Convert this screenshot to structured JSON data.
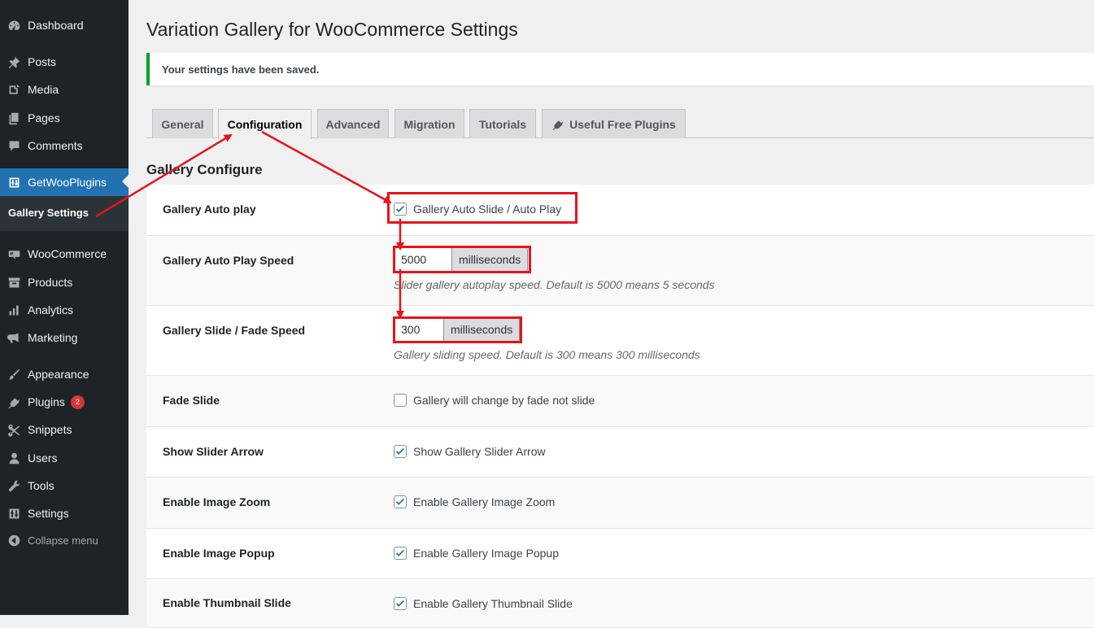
{
  "sidebar": {
    "items": [
      {
        "label": "Dashboard",
        "icon": "dashboard-icon"
      },
      {
        "label": "Posts",
        "icon": "pin-icon"
      },
      {
        "label": "Media",
        "icon": "media-icon"
      },
      {
        "label": "Pages",
        "icon": "pages-icon"
      },
      {
        "label": "Comments",
        "icon": "comment-icon"
      },
      {
        "label": "GetWooPlugins",
        "icon": "plugin-settings-icon"
      },
      {
        "label": "WooCommerce",
        "icon": "woo-icon"
      },
      {
        "label": "Products",
        "icon": "archive-icon"
      },
      {
        "label": "Analytics",
        "icon": "bar-chart-icon"
      },
      {
        "label": "Marketing",
        "icon": "megaphone-icon"
      },
      {
        "label": "Appearance",
        "icon": "brush-icon"
      },
      {
        "label": "Plugins",
        "icon": "plug-icon",
        "badge": "2"
      },
      {
        "label": "Snippets",
        "icon": "scissors-icon"
      },
      {
        "label": "Users",
        "icon": "user-icon"
      },
      {
        "label": "Tools",
        "icon": "wrench-icon"
      },
      {
        "label": "Settings",
        "icon": "settings-icon"
      },
      {
        "label": "Collapse menu",
        "icon": "collapse-icon"
      }
    ],
    "submenu": {
      "label": "Gallery Settings"
    }
  },
  "page": {
    "title": "Variation Gallery for WooCommerce Settings",
    "notice": "Your settings have been saved.",
    "section_title": "Gallery Configure"
  },
  "tabs": [
    {
      "label": "General"
    },
    {
      "label": "Configuration"
    },
    {
      "label": "Advanced"
    },
    {
      "label": "Migration"
    },
    {
      "label": "Tutorials"
    },
    {
      "label": "Useful Free Plugins",
      "icon": "plug-icon"
    }
  ],
  "settings": {
    "auto_play": {
      "label": "Gallery Auto play",
      "checkbox_label": "Gallery Auto Slide / Auto Play",
      "checked": true
    },
    "auto_play_speed": {
      "label": "Gallery Auto Play Speed",
      "value": "5000",
      "unit": "milliseconds",
      "description": "Slider gallery autoplay speed. Default is 5000 means 5 seconds"
    },
    "slide_speed": {
      "label": "Gallery Slide / Fade Speed",
      "value": "300",
      "unit": "milliseconds",
      "description": "Gallery sliding speed. Default is 300 means 300 milliseconds"
    },
    "fade_slide": {
      "label": "Fade Slide",
      "checkbox_label": "Gallery will change by fade not slide",
      "checked": false
    },
    "slider_arrow": {
      "label": "Show Slider Arrow",
      "checkbox_label": "Show Gallery Slider Arrow",
      "checked": true
    },
    "image_zoom": {
      "label": "Enable Image Zoom",
      "checkbox_label": "Enable Gallery Image Zoom",
      "checked": true
    },
    "image_popup": {
      "label": "Enable Image Popup",
      "checkbox_label": "Enable Gallery Image Popup",
      "checked": true
    },
    "thumbnail_slide": {
      "label": "Enable Thumbnail Slide",
      "checkbox_label": "Enable Gallery Thumbnail Slide",
      "checked": true
    }
  },
  "colors": {
    "sidebar_bg": "#1d2327",
    "active_menu": "#2271b1",
    "success": "#00a32a",
    "annotation": "#e5141c",
    "checkbox_check": "#2271b1"
  }
}
